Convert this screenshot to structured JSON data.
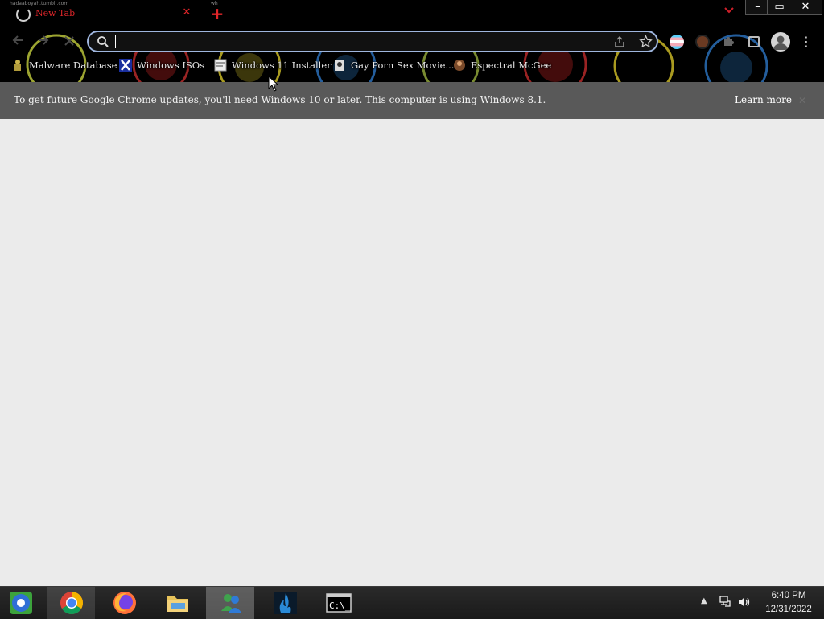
{
  "browser": {
    "watermark_text": "hadaaboyah.tumblr.com",
    "watermark_text_2": "wh",
    "tab": {
      "title": "New Tab"
    },
    "window_controls": {
      "minimize": "–",
      "maximize": "▭",
      "close": "✕"
    },
    "omnibox": {
      "value": "",
      "placeholder": ""
    }
  },
  "bookmarks": [
    {
      "label": "Malware Database",
      "icon": "malware-icon"
    },
    {
      "label": "Windows ISOs",
      "icon": "x-icon"
    },
    {
      "label": "Windows 11 Installer",
      "icon": "page-icon"
    },
    {
      "label": "Gay Porn Sex Movie...",
      "icon": "site-icon"
    },
    {
      "label": "Espectral McGee",
      "icon": "avatar-icon"
    }
  ],
  "infobar": {
    "message": "To get future Google Chrome updates, you'll need Windows 10 or later. This computer is using Windows 8.1.",
    "link": "Learn more",
    "close": "✕"
  },
  "taskbar": {
    "apps": [
      {
        "name": "chromium",
        "active": false
      },
      {
        "name": "chrome",
        "active": true
      },
      {
        "name": "firefox",
        "active": false
      },
      {
        "name": "file-explorer",
        "active": false
      },
      {
        "name": "windows-live-messenger",
        "active": true
      },
      {
        "name": "app-blue-flame",
        "active": false
      },
      {
        "name": "command-prompt",
        "active": false
      }
    ],
    "tray_arrow": "▲",
    "time": "6:40 PM",
    "date": "12/31/2022"
  }
}
